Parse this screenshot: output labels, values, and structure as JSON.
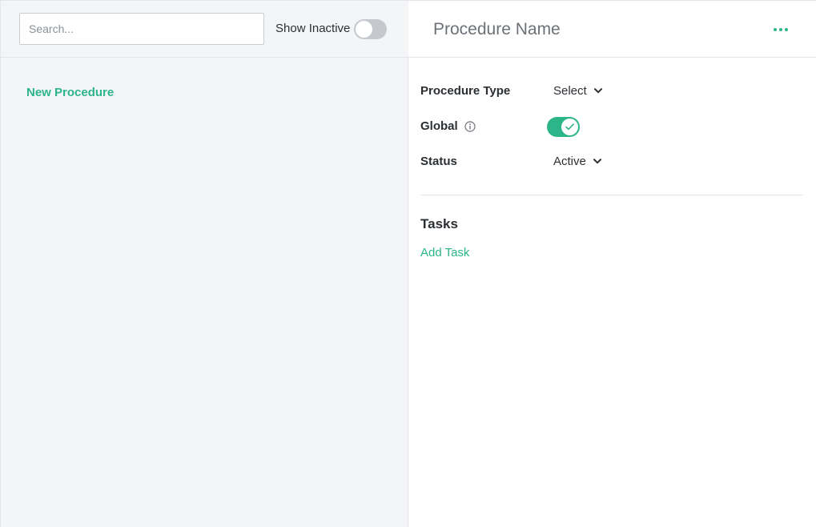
{
  "sidebar": {
    "search": {
      "placeholder": "Search...",
      "value": ""
    },
    "show_inactive": {
      "label": "Show Inactive",
      "on": false
    },
    "new_procedure_label": "New Procedure"
  },
  "detail": {
    "title": "Procedure Name",
    "more_icon": "more-horizontal-icon",
    "fields": {
      "procedure_type": {
        "label": "Procedure Type",
        "value": "Select"
      },
      "global": {
        "label": "Global",
        "on": true,
        "info_icon": "info-icon"
      },
      "status": {
        "label": "Status",
        "value": "Active"
      }
    },
    "tasks": {
      "heading": "Tasks",
      "add_label": "Add Task"
    }
  },
  "colors": {
    "accent": "#2db58a",
    "pane_bg": "#f4f5f7",
    "border": "#e3e5e8",
    "toggle_off": "#c5c9ce"
  }
}
